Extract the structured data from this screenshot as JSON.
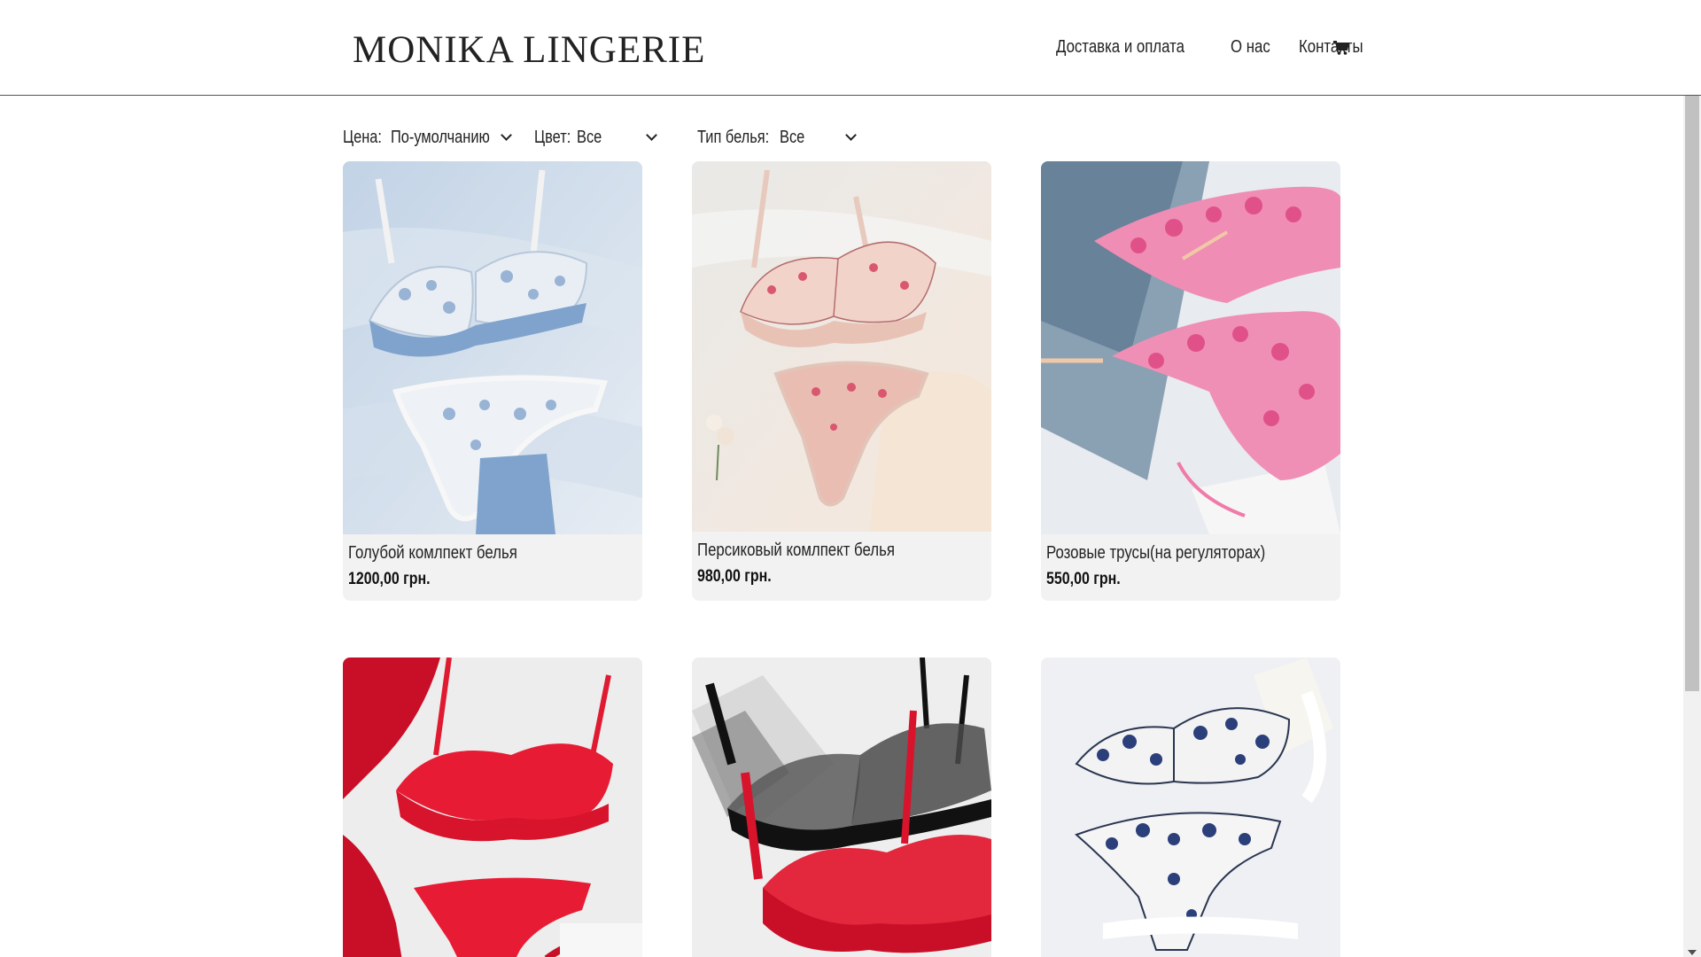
{
  "header": {
    "logo": "MONIKA LINGERIE",
    "nav": [
      "Доставка и оплата",
      "О нас",
      "Контакты"
    ],
    "cart_icon": "cart-icon"
  },
  "filters": [
    {
      "label": "Цена:",
      "value": "По-умолчанию"
    },
    {
      "label": "Цвет:",
      "value": "Все"
    },
    {
      "label": "Тип белья:",
      "value": "Все"
    }
  ],
  "products": [
    {
      "name": "Голубой комлпект белья",
      "price": "1200,00 грн."
    },
    {
      "name": "Персиковый комлпект белья",
      "price": "980,00 грн."
    },
    {
      "name": "Розовые трусы(на регуляторах)",
      "price": "550,00 грн."
    },
    {
      "name": "",
      "price": ""
    },
    {
      "name": "",
      "price": ""
    },
    {
      "name": "",
      "price": ""
    }
  ],
  "colors": {
    "accent_loadbar": "#2a7fc1",
    "card_bg": "#f2f2f2",
    "text": "#222222"
  }
}
